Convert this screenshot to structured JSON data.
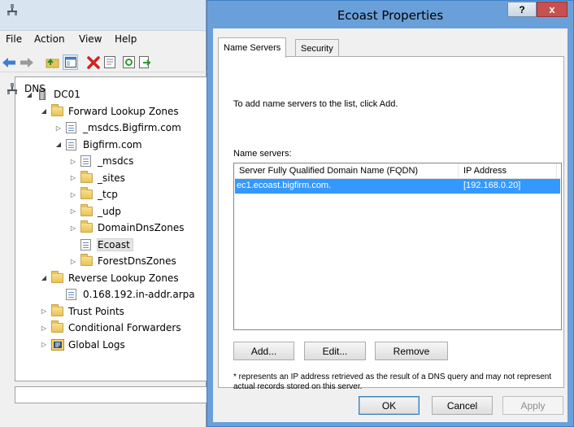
{
  "dns_manager": {
    "menu": [
      "File",
      "Action",
      "View",
      "Help"
    ],
    "tree": [
      {
        "label": "DNS",
        "level": 0,
        "icon": "dns-icon",
        "expander": ""
      },
      {
        "label": "DC01",
        "level": 1,
        "icon": "server-icon",
        "expander": "expanded"
      },
      {
        "label": "Forward Lookup Zones",
        "level": 2,
        "icon": "folder-icon",
        "expander": "expanded"
      },
      {
        "label": "_msdcs.Bigfirm.com",
        "level": 3,
        "icon": "zone-icon",
        "expander": "collapsed"
      },
      {
        "label": "Bigfirm.com",
        "level": 3,
        "icon": "zone-icon",
        "expander": "expanded"
      },
      {
        "label": "_msdcs",
        "level": 4,
        "icon": "zone-icon",
        "expander": "collapsed"
      },
      {
        "label": "_sites",
        "level": 4,
        "icon": "folder-icon",
        "expander": "collapsed"
      },
      {
        "label": "_tcp",
        "level": 4,
        "icon": "folder-icon",
        "expander": "collapsed"
      },
      {
        "label": "_udp",
        "level": 4,
        "icon": "folder-icon",
        "expander": "collapsed"
      },
      {
        "label": "DomainDnsZones",
        "level": 4,
        "icon": "folder-icon",
        "expander": "collapsed"
      },
      {
        "label": "Ecoast",
        "level": 4,
        "icon": "zone-icon",
        "expander": "",
        "selected": true
      },
      {
        "label": "ForestDnsZones",
        "level": 4,
        "icon": "folder-icon",
        "expander": "collapsed"
      },
      {
        "label": "Reverse Lookup Zones",
        "level": 2,
        "icon": "folder-icon",
        "expander": "expanded"
      },
      {
        "label": "0.168.192.in-addr.arpa",
        "level": 3,
        "icon": "zone-icon",
        "expander": ""
      },
      {
        "label": "Trust Points",
        "level": 2,
        "icon": "folder-icon",
        "expander": "collapsed"
      },
      {
        "label": "Conditional Forwarders",
        "level": 2,
        "icon": "folder-icon",
        "expander": "collapsed"
      },
      {
        "label": "Global Logs",
        "level": 2,
        "icon": "log-icon",
        "expander": "collapsed"
      }
    ]
  },
  "dialog": {
    "title": "Ecoast Properties",
    "help_label": "?",
    "close_label": "x",
    "tabs": [
      "Name Servers",
      "Security"
    ],
    "intro": "To add name servers to the list, click Add.",
    "list_label": "Name servers:",
    "columns": [
      "Server Fully Qualified Domain Name (FQDN)",
      "IP Address"
    ],
    "rows": [
      {
        "fqdn": "ec1.ecoast.bigfirm.com.",
        "ip": "[192.168.0.20]"
      }
    ],
    "add_label": "Add...",
    "edit_label": "Edit...",
    "remove_label": "Remove",
    "note": "* represents an IP address retrieved as the result of a DNS query and may not represent actual records stored on this server.",
    "ok_label": "OK",
    "cancel_label": "Cancel",
    "apply_label": "Apply"
  },
  "colors": {
    "title_active": "#6aa0da",
    "selection": "#3399ff",
    "close_red": "#c75050"
  }
}
